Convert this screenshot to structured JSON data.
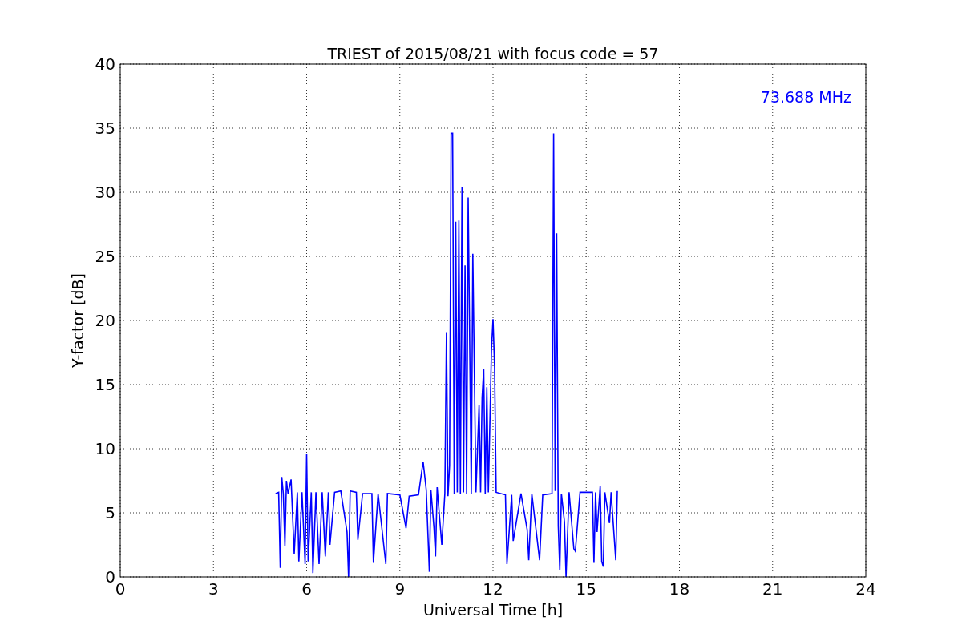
{
  "chart_data": {
    "type": "line",
    "title": "TRIEST of 2015/08/21 with focus code = 57",
    "xlabel": "Universal Time [h]",
    "ylabel": "Y-factor [dB]",
    "x": [
      5.0,
      5.1,
      5.15,
      5.2,
      5.25,
      5.3,
      5.35,
      5.4,
      5.5,
      5.6,
      5.7,
      5.75,
      5.85,
      5.95,
      6.0,
      6.05,
      6.15,
      6.2,
      6.3,
      6.4,
      6.5,
      6.6,
      6.7,
      6.75,
      6.9,
      7.1,
      7.3,
      7.35,
      7.4,
      7.6,
      7.65,
      7.8,
      8.1,
      8.15,
      8.3,
      8.55,
      8.6,
      9.0,
      9.2,
      9.3,
      9.6,
      9.75,
      9.85,
      9.95,
      10.0,
      10.1,
      10.15,
      10.2,
      10.35,
      10.45,
      10.5,
      10.55,
      10.6,
      10.65,
      10.7,
      10.75,
      10.8,
      10.85,
      10.9,
      10.95,
      11.0,
      11.05,
      11.1,
      11.15,
      11.2,
      11.3,
      11.35,
      11.45,
      11.55,
      11.6,
      11.65,
      11.7,
      11.75,
      11.8,
      11.85,
      11.95,
      12.0,
      12.05,
      12.1,
      12.4,
      12.45,
      12.6,
      12.65,
      12.9,
      13.1,
      13.15,
      13.25,
      13.5,
      13.6,
      13.9,
      13.95,
      14.0,
      14.05,
      14.1,
      14.15,
      14.2,
      14.3,
      14.35,
      14.45,
      14.6,
      14.65,
      14.8,
      15.2,
      15.25,
      15.3,
      15.35,
      15.45,
      15.5,
      15.55,
      15.6,
      15.75,
      15.8,
      15.95,
      16.0
    ],
    "series": [
      {
        "name": "73.688 MHz",
        "color": "#0000ff",
        "values": [
          6.5,
          6.6,
          0.7,
          7.8,
          6.5,
          2.4,
          7.5,
          6.5,
          7.6,
          1.8,
          6.6,
          1.2,
          6.6,
          1.0,
          9.6,
          1.2,
          6.6,
          0.3,
          6.6,
          1.0,
          6.6,
          1.6,
          6.6,
          2.5,
          6.6,
          6.7,
          3.5,
          0.0,
          6.7,
          6.6,
          2.9,
          6.5,
          6.5,
          1.1,
          6.5,
          1.0,
          6.5,
          6.4,
          3.8,
          6.3,
          6.4,
          9.0,
          6.8,
          0.4,
          6.8,
          3.8,
          1.6,
          7.0,
          2.5,
          6.5,
          19.1,
          6.3,
          8.7,
          34.6,
          34.6,
          6.5,
          27.7,
          6.6,
          27.8,
          6.5,
          30.4,
          6.6,
          24.3,
          6.5,
          29.6,
          6.5,
          25.2,
          6.6,
          13.4,
          6.6,
          14.0,
          16.2,
          6.5,
          14.8,
          6.6,
          17.8,
          20.1,
          16.5,
          6.6,
          6.4,
          1.0,
          6.4,
          2.8,
          6.5,
          3.7,
          1.3,
          6.5,
          1.3,
          6.4,
          6.5,
          34.6,
          6.7,
          26.8,
          4.0,
          0.5,
          6.5,
          4.3,
          0.0,
          6.6,
          2.2,
          2.0,
          6.6,
          6.6,
          1.1,
          6.6,
          3.5,
          7.1,
          1.2,
          0.8,
          6.6,
          4.2,
          6.6,
          1.3,
          6.7
        ]
      }
    ],
    "xlim": [
      0,
      24
    ],
    "ylim": [
      0,
      40
    ],
    "xticks": [
      0,
      3,
      6,
      9,
      12,
      15,
      18,
      21,
      24
    ],
    "yticks": [
      0,
      5,
      10,
      15,
      20,
      25,
      30,
      35,
      40
    ],
    "grid": true
  }
}
